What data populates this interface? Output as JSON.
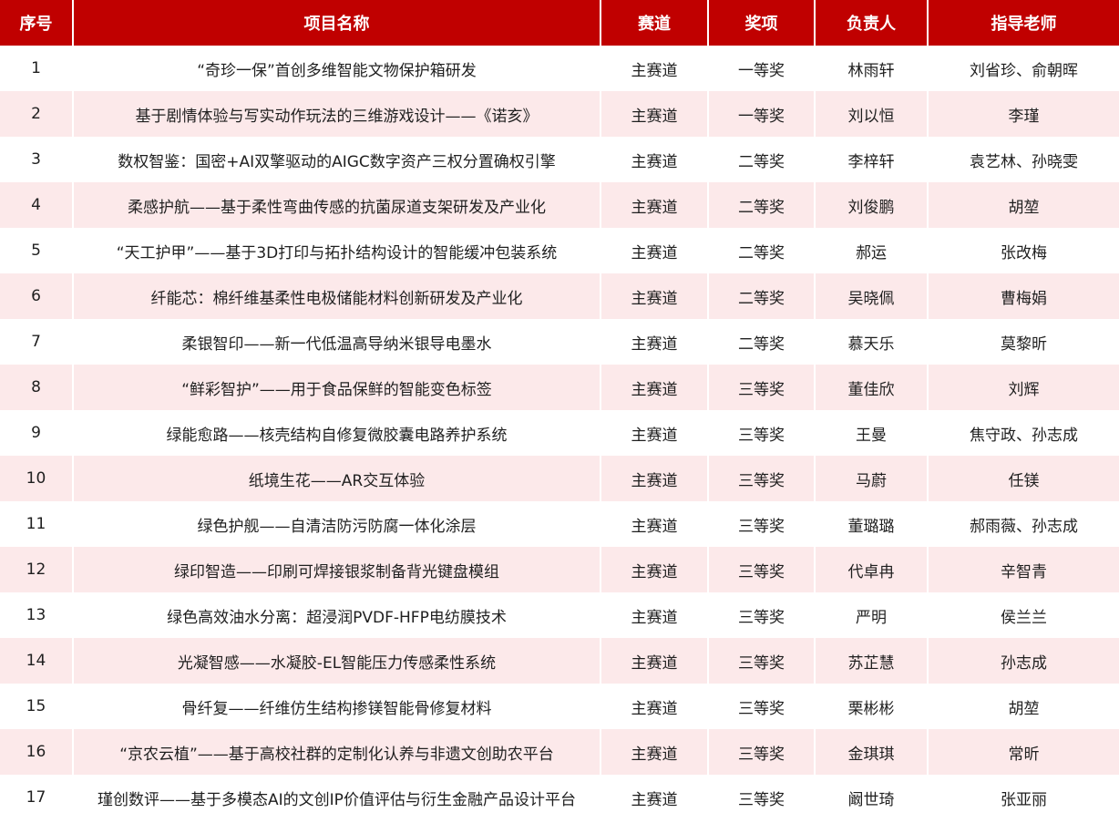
{
  "header": {
    "seq": "序号",
    "name": "项目名称",
    "track": "赛道",
    "award": "奖项",
    "leader": "负责人",
    "advisor": "指导老师"
  },
  "rows": [
    {
      "seq": "1",
      "name": "“奇珍一保”首创多维智能文物保护箱研发",
      "track": "主赛道",
      "award": "一等奖",
      "leader": "林雨轩",
      "advisor": "刘省珍、俞朝晖"
    },
    {
      "seq": "2",
      "name": "基于剧情体验与写实动作玩法的三维游戏设计——《诺亥》",
      "track": "主赛道",
      "award": "一等奖",
      "leader": "刘以恒",
      "advisor": "李瑾"
    },
    {
      "seq": "3",
      "name": "数权智鉴：国密+AI双擎驱动的AIGC数字资产三权分置确权引擎",
      "track": "主赛道",
      "award": "二等奖",
      "leader": "李梓轩",
      "advisor": "袁艺林、孙晓雯"
    },
    {
      "seq": "4",
      "name": "柔感护航——基于柔性弯曲传感的抗菌尿道支架研发及产业化",
      "track": "主赛道",
      "award": "二等奖",
      "leader": "刘俊鹏",
      "advisor": "胡堃"
    },
    {
      "seq": "5",
      "name": "“天工护甲”——基于3D打印与拓扑结构设计的智能缓冲包装系统",
      "track": "主赛道",
      "award": "二等奖",
      "leader": "郝运",
      "advisor": "张改梅"
    },
    {
      "seq": "6",
      "name": "纤能芯：棉纤维基柔性电极储能材料创新研发及产业化",
      "track": "主赛道",
      "award": "二等奖",
      "leader": "吴晓佩",
      "advisor": "曹梅娟"
    },
    {
      "seq": "7",
      "name": "柔银智印——新一代低温高导纳米银导电墨水",
      "track": "主赛道",
      "award": "二等奖",
      "leader": "慕天乐",
      "advisor": "莫黎昕"
    },
    {
      "seq": "8",
      "name": "“鲜彩智护”——用于食品保鲜的智能变色标签",
      "track": "主赛道",
      "award": "三等奖",
      "leader": "董佳欣",
      "advisor": "刘辉"
    },
    {
      "seq": "9",
      "name": "绿能愈路——核壳结构自修复微胶囊电路养护系统",
      "track": "主赛道",
      "award": "三等奖",
      "leader": "王曼",
      "advisor": "焦守政、孙志成"
    },
    {
      "seq": "10",
      "name": "纸境生花——AR交互体验",
      "track": "主赛道",
      "award": "三等奖",
      "leader": "马蔚",
      "advisor": "任镁"
    },
    {
      "seq": "11",
      "name": "绿色护舰——自清洁防污防腐一体化涂层",
      "track": "主赛道",
      "award": "三等奖",
      "leader": "董璐璐",
      "advisor": "郝雨薇、孙志成"
    },
    {
      "seq": "12",
      "name": "绿印智造——印刷可焊接银浆制备背光键盘模组",
      "track": "主赛道",
      "award": "三等奖",
      "leader": "代卓冉",
      "advisor": "辛智青"
    },
    {
      "seq": "13",
      "name": "绿色高效油水分离：超浸润PVDF-HFP电纺膜技术",
      "track": "主赛道",
      "award": "三等奖",
      "leader": "严明",
      "advisor": "侯兰兰"
    },
    {
      "seq": "14",
      "name": "光凝智感——水凝胶-EL智能压力传感柔性系统",
      "track": "主赛道",
      "award": "三等奖",
      "leader": "苏芷慧",
      "advisor": "孙志成"
    },
    {
      "seq": "15",
      "name": "骨纤复——纤维仿生结构掺镁智能骨修复材料",
      "track": "主赛道",
      "award": "三等奖",
      "leader": "栗彬彬",
      "advisor": "胡堃"
    },
    {
      "seq": "16",
      "name": "“京农云植”——基于高校社群的定制化认养与非遗文创助农平台",
      "track": "主赛道",
      "award": "三等奖",
      "leader": "金琪琪",
      "advisor": "常昕"
    },
    {
      "seq": "17",
      "name": "瑾创数评——基于多模态AI的文创IP价值评估与衍生金融产品设计平台",
      "track": "主赛道",
      "award": "三等奖",
      "leader": "阚世琦",
      "advisor": "张亚丽"
    }
  ],
  "colors": {
    "header_bg": "#c00000",
    "header_text": "#ffffff",
    "stripe_bg": "#fce9ea",
    "row_bg": "#ffffff"
  }
}
